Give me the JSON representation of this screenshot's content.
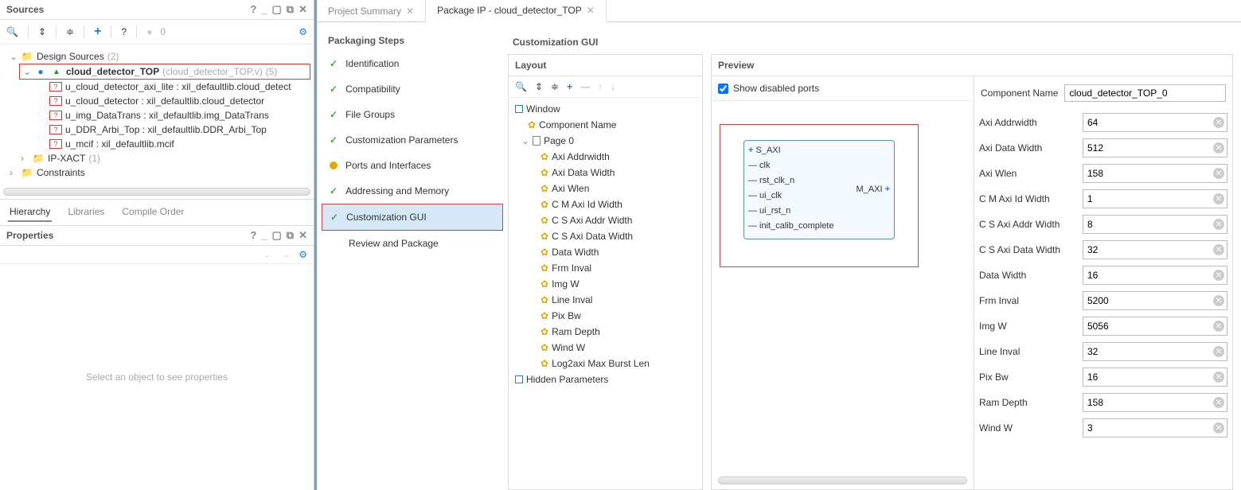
{
  "sources": {
    "title": "Sources",
    "zero_count": "0",
    "root": "Design Sources",
    "root_count": "(2)",
    "top_module": "cloud_detector_TOP",
    "top_module_file": "(cloud_detector_TOP.v)",
    "top_module_count": "(5)",
    "children": [
      "u_cloud_detector_axi_lite : xil_defaultlib.cloud_detect",
      "u_cloud_detector : xil_defaultlib.cloud_detector",
      "u_img_DataTrans : xil_defaultlib.img_DataTrans",
      "u_DDR_Arbi_Top : xil_defaultlib.DDR_Arbi_Top",
      "u_mcif : xil_defaultlib.mcif"
    ],
    "ipxact": "IP-XACT",
    "ipxact_count": "(1)",
    "constraints": "Constraints",
    "hier_tabs": {
      "hierarchy": "Hierarchy",
      "libraries": "Libraries",
      "compile": "Compile Order"
    }
  },
  "properties": {
    "title": "Properties",
    "empty_msg": "Select an object to see properties"
  },
  "tabs": {
    "summary": "Project Summary",
    "package": "Package IP - cloud_detector_TOP"
  },
  "packaging": {
    "header": "Packaging Steps",
    "items": [
      {
        "label": "Identification",
        "status": "check"
      },
      {
        "label": "Compatibility",
        "status": "check"
      },
      {
        "label": "File Groups",
        "status": "check"
      },
      {
        "label": "Customization Parameters",
        "status": "check"
      },
      {
        "label": "Ports and Interfaces",
        "status": "warn"
      },
      {
        "label": "Addressing and Memory",
        "status": "check"
      },
      {
        "label": "Customization GUI",
        "status": "check",
        "selected": true
      },
      {
        "label": "Review and Package",
        "status": ""
      }
    ]
  },
  "gui": {
    "header": "Customization GUI",
    "layout_title": "Layout",
    "window": "Window",
    "component_name_node": "Component Name",
    "page0": "Page 0",
    "hidden": "Hidden Parameters",
    "params_tree": [
      "Axi Addrwidth",
      "Axi Data Width",
      "Axi Wlen",
      "C M Axi Id Width",
      "C S Axi Addr Width",
      "C S Axi Data Width",
      "Data Width",
      "Frm Inval",
      "Img W",
      "Line Inval",
      "Pix Bw",
      "Ram Depth",
      "Wind W",
      "Log2axi Max Burst Len"
    ]
  },
  "preview": {
    "title": "Preview",
    "show_disabled": "Show disabled ports",
    "component_name_label": "Component Name",
    "component_name_value": "cloud_detector_TOP_0",
    "ports_left": [
      "S_AXI",
      "clk",
      "rst_clk_n",
      "ui_clk",
      "ui_rst_n",
      "init_calib_complete"
    ],
    "port_right": "M_AXI",
    "params": [
      {
        "label": "Axi Addrwidth",
        "value": "64"
      },
      {
        "label": "Axi Data Width",
        "value": "512"
      },
      {
        "label": "Axi Wlen",
        "value": "158"
      },
      {
        "label": "C M Axi Id Width",
        "value": "1"
      },
      {
        "label": "C S Axi Addr Width",
        "value": "8"
      },
      {
        "label": "C S Axi Data Width",
        "value": "32"
      },
      {
        "label": "Data Width",
        "value": "16"
      },
      {
        "label": "Frm Inval",
        "value": "5200"
      },
      {
        "label": "Img W",
        "value": "5056"
      },
      {
        "label": "Line Inval",
        "value": "32"
      },
      {
        "label": "Pix Bw",
        "value": "16"
      },
      {
        "label": "Ram Depth",
        "value": "158"
      },
      {
        "label": "Wind W",
        "value": "3"
      }
    ]
  }
}
